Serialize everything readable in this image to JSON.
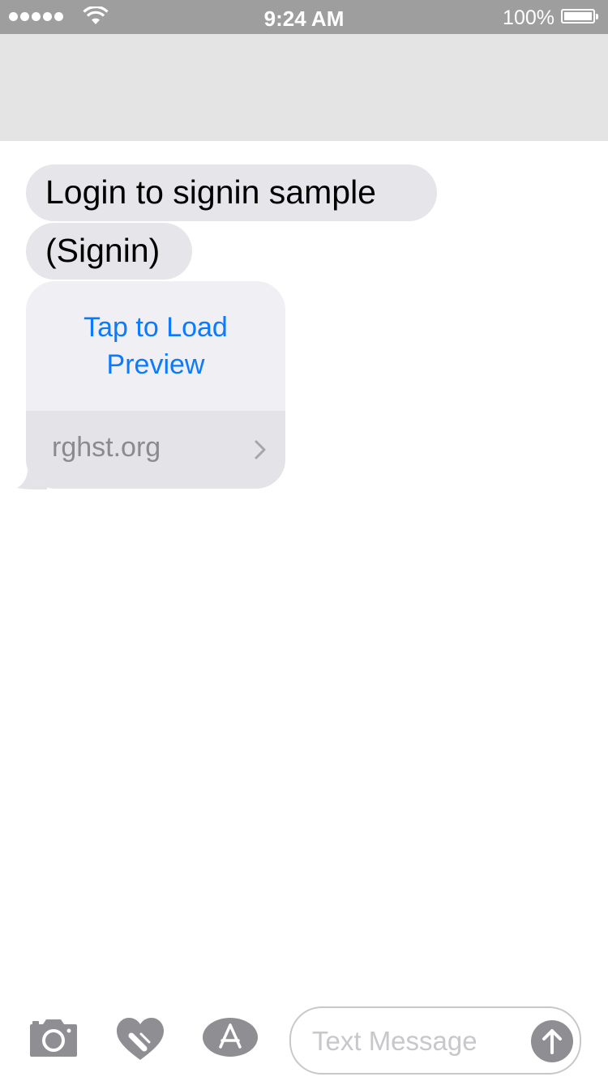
{
  "status_bar": {
    "time": "9:24 AM",
    "battery_percent": "100%",
    "signal_bars": 5,
    "icons": [
      "signal-icon",
      "wifi-icon",
      "battery-icon"
    ]
  },
  "messages": [
    {
      "text": "Login to signin sample"
    },
    {
      "text": "(Signin)"
    }
  ],
  "link_preview": {
    "action_label": "Tap to Load Preview",
    "domain": "rghst.org",
    "action_color": "#0a7aff"
  },
  "toolbar": {
    "icons": [
      "camera-icon",
      "digital-touch-heart-icon",
      "app-store-icon"
    ],
    "message_placeholder": "Text Message",
    "send_icon": "send-arrow-up-icon"
  }
}
